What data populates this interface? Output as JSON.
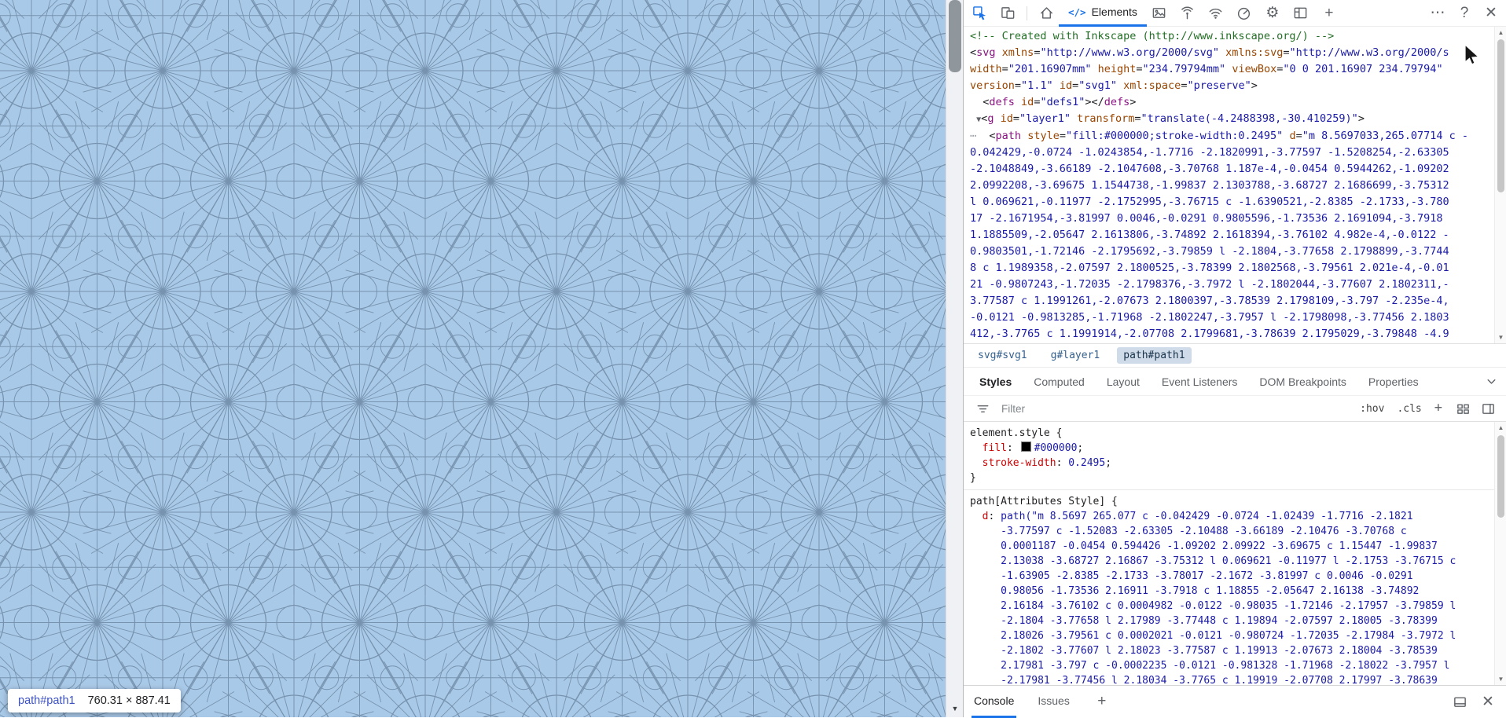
{
  "page": {
    "pattern": {
      "background": "#a9c9e8",
      "line_color": "#46607a"
    },
    "tooltip": {
      "element": "path#path1",
      "dimensions": "760.31 × 887.41"
    }
  },
  "devtools": {
    "toolbar": {
      "left_icons": [
        {
          "name": "inspect-icon",
          "active": true
        },
        {
          "name": "device-toolbar-icon",
          "active": false
        }
      ],
      "home_icon": {
        "name": "home-icon"
      },
      "elements_tab": {
        "icon_text": "</>",
        "label": "Elements"
      },
      "tool_icons": [
        {
          "name": "media-icon"
        },
        {
          "name": "network-conditions-icon"
        },
        {
          "name": "wifi-icon"
        },
        {
          "name": "performance-icon"
        },
        {
          "name": "settings-gear-icon"
        },
        {
          "name": "layout-icon"
        },
        {
          "name": "add-tool-icon"
        }
      ],
      "window_icons": [
        {
          "name": "more-options-icon"
        },
        {
          "name": "help-icon"
        },
        {
          "name": "close-devtools-icon"
        }
      ]
    },
    "dom_tree": {
      "lines": [
        {
          "segments": [
            [
              "cm",
              "<!-- Created with Inkscape (http://www.inkscape.org/) -->"
            ]
          ]
        },
        {
          "segments": [
            [
              "pl",
              "<"
            ],
            [
              "tag",
              "svg"
            ],
            [
              "pl",
              " "
            ],
            [
              "at",
              "xmlns"
            ],
            [
              "pl",
              "="
            ],
            [
              "av",
              "\"http://www.w3.org/2000/svg\""
            ],
            [
              "pl",
              " "
            ],
            [
              "at",
              "xmlns:svg"
            ],
            [
              "pl",
              "="
            ],
            [
              "av",
              "\"http://www.w3.org/2000/s"
            ]
          ]
        },
        {
          "segments": [
            [
              "at",
              "width"
            ],
            [
              "pl",
              "="
            ],
            [
              "av",
              "\"201.16907mm\""
            ],
            [
              "pl",
              " "
            ],
            [
              "at",
              "height"
            ],
            [
              "pl",
              "="
            ],
            [
              "av",
              "\"234.79794mm\""
            ],
            [
              "pl",
              " "
            ],
            [
              "at",
              "viewBox"
            ],
            [
              "pl",
              "="
            ],
            [
              "av",
              "\"0 0 201.16907 234.79794\""
            ]
          ]
        },
        {
          "segments": [
            [
              "at",
              "version"
            ],
            [
              "pl",
              "="
            ],
            [
              "av",
              "\"1.1\""
            ],
            [
              "pl",
              " "
            ],
            [
              "at",
              "id"
            ],
            [
              "pl",
              "="
            ],
            [
              "av",
              "\"svg1\""
            ],
            [
              "pl",
              " "
            ],
            [
              "at",
              "xml:space"
            ],
            [
              "pl",
              "="
            ],
            [
              "av",
              "\"preserve\""
            ],
            [
              "pl",
              ">"
            ]
          ]
        },
        {
          "segments": [
            [
              "pl",
              "  <"
            ],
            [
              "tag",
              "defs"
            ],
            [
              "pl",
              " "
            ],
            [
              "at",
              "id"
            ],
            [
              "pl",
              "="
            ],
            [
              "av",
              "\"defs1\""
            ],
            [
              "pl",
              "></"
            ],
            [
              "tag",
              "defs"
            ],
            [
              "pl",
              ">"
            ]
          ]
        },
        {
          "segments": [
            [
              "pl",
              " "
            ],
            [
              "arw",
              "▼"
            ],
            [
              "pl",
              "<"
            ],
            [
              "tag",
              "g"
            ],
            [
              "pl",
              " "
            ],
            [
              "at",
              "id"
            ],
            [
              "pl",
              "="
            ],
            [
              "av",
              "\"layer1\""
            ],
            [
              "pl",
              " "
            ],
            [
              "at",
              "transform"
            ],
            [
              "pl",
              "="
            ],
            [
              "av",
              "\"translate(-4.2488398,-30.410259)\""
            ],
            [
              "pl",
              ">"
            ]
          ]
        },
        {
          "segments": [
            [
              "gut",
              "⋯"
            ],
            [
              "pl",
              "  <"
            ],
            [
              "tag",
              "path"
            ],
            [
              "pl",
              " "
            ],
            [
              "at",
              "style"
            ],
            [
              "pl",
              "="
            ],
            [
              "av",
              "\"fill:#000000;stroke-width:0.2495\""
            ],
            [
              "pl",
              " "
            ],
            [
              "at",
              "d"
            ],
            [
              "pl",
              "="
            ],
            [
              "av",
              "\"m 8.5697033,265.07714 c -"
            ]
          ]
        },
        {
          "segments": [
            [
              "av",
              "0.042429,-0.0724 -1.0243854,-1.7716 -2.1820991,-3.77597 -1.5208254,-2.63305"
            ]
          ]
        },
        {
          "segments": [
            [
              "av",
              "-2.1048849,-3.66189 -2.1047608,-3.70768 1.187e-4,-0.0454 0.5944262,-1.09202"
            ]
          ]
        },
        {
          "segments": [
            [
              "av",
              "2.0992208,-3.69675 1.1544738,-1.99837 2.1303788,-3.68727 2.1686699,-3.75312"
            ]
          ]
        },
        {
          "segments": [
            [
              "av",
              "l 0.069621,-0.11977 -2.1752995,-3.76715 c -1.6390521,-2.8385 -2.1733,-3.780"
            ]
          ]
        },
        {
          "segments": [
            [
              "av",
              "17 -2.1671954,-3.81997 0.0046,-0.0291 0.9805596,-1.73536 2.1691094,-3.7918"
            ]
          ]
        },
        {
          "segments": [
            [
              "av",
              "1.1885509,-2.05647 2.1613806,-3.74892 2.1618394,-3.76102 4.982e-4,-0.0122 -"
            ]
          ]
        },
        {
          "segments": [
            [
              "av",
              "0.9803501,-1.72146 -2.1795692,-3.79859 l -2.1804,-3.77658 2.1798899,-3.7744"
            ]
          ]
        },
        {
          "segments": [
            [
              "av",
              "8 c 1.1989358,-2.07597 2.1800525,-3.78399 2.1802568,-3.79561 2.021e-4,-0.01"
            ]
          ]
        },
        {
          "segments": [
            [
              "av",
              "21 -0.9807243,-1.72035 -2.1798376,-3.7972 l -2.1802044,-3.77607 2.1802311,-"
            ]
          ]
        },
        {
          "segments": [
            [
              "av",
              "3.77587 c 1.1991261,-2.07673 2.1800397,-3.78539 2.1798109,-3.797 -2.235e-4,"
            ]
          ]
        },
        {
          "segments": [
            [
              "av",
              "-0.0121 -0.9813285,-1.71968 -2.1802247,-3.7957 l -2.1798098,-3.77456 2.1803"
            ]
          ]
        },
        {
          "segments": [
            [
              "av",
              "412,-3.7765 c 1.1991914,-2.07708 2.1799681,-3.78639 2.1795029,-3.79848 -4.9"
            ]
          ]
        }
      ]
    },
    "breadcrumb": {
      "items": [
        {
          "label": "svg#svg1",
          "selected": false
        },
        {
          "label": "g#layer1",
          "selected": false
        },
        {
          "label": "path#path1",
          "selected": true
        }
      ]
    },
    "panel_tabs": {
      "items": [
        {
          "label": "Styles",
          "selected": true
        },
        {
          "label": "Computed",
          "selected": false
        },
        {
          "label": "Layout",
          "selected": false
        },
        {
          "label": "Event Listeners",
          "selected": false
        },
        {
          "label": "DOM Breakpoints",
          "selected": false
        },
        {
          "label": "Properties",
          "selected": false
        }
      ]
    },
    "filter_bar": {
      "placeholder": "Filter",
      "pseudo_toggle": ":hov",
      "class_toggle": ".cls",
      "new_rule": "+",
      "icons": [
        {
          "name": "grid-icon"
        },
        {
          "name": "sidebar-icon"
        }
      ]
    },
    "styles_pane": {
      "rules": [
        {
          "lines": [
            {
              "segments": [
                [
                  "sel",
                  "element.style"
                ],
                [
                  "pl",
                  " {"
                ]
              ]
            },
            {
              "segments": [
                [
                  "prop",
                  "  fill"
                ],
                [
                  "pl",
                  ": "
                ],
                [
                  "swatch",
                  "#000000"
                ],
                [
                  "val",
                  "#000000"
                ],
                [
                  "pl",
                  ";"
                ]
              ]
            },
            {
              "segments": [
                [
                  "prop",
                  "  stroke-width"
                ],
                [
                  "pl",
                  ": "
                ],
                [
                  "val",
                  "0.2495"
                ],
                [
                  "pl",
                  ";"
                ]
              ]
            },
            {
              "segments": [
                [
                  "pl",
                  "}"
                ]
              ]
            }
          ]
        },
        {
          "lines": [
            {
              "segments": [
                [
                  "sel",
                  "path[Attributes Style]"
                ],
                [
                  "pl",
                  " {"
                ]
              ]
            },
            {
              "segments": [
                [
                  "prop",
                  "  d"
                ],
                [
                  "pl",
                  ": "
                ],
                [
                  "val",
                  "path(\"m 8.5697 265.077 c -0.042429 -0.0724 -1.02439 -1.7716 -2.1821"
                ]
              ]
            },
            {
              "segments": [
                [
                  "val",
                  "     -3.77597 c -1.52083 -2.63305 -2.10488 -3.66189 -2.10476 -3.70768 c"
                ]
              ]
            },
            {
              "segments": [
                [
                  "val",
                  "     0.0001187 -0.0454 0.594426 -1.09202 2.09922 -3.69675 c 1.15447 -1.99837"
                ]
              ]
            },
            {
              "segments": [
                [
                  "val",
                  "     2.13038 -3.68727 2.16867 -3.75312 l 0.069621 -0.11977 l -2.1753 -3.76715 c"
                ]
              ]
            },
            {
              "segments": [
                [
                  "val",
                  "     -1.63905 -2.8385 -2.1733 -3.78017 -2.1672 -3.81997 c 0.0046 -0.0291"
                ]
              ]
            },
            {
              "segments": [
                [
                  "val",
                  "     0.98056 -1.73536 2.16911 -3.7918 c 1.18855 -2.05647 2.16138 -3.74892"
                ]
              ]
            },
            {
              "segments": [
                [
                  "val",
                  "     2.16184 -3.76102 c 0.0004982 -0.0122 -0.98035 -1.72146 -2.17957 -3.79859 l"
                ]
              ]
            },
            {
              "segments": [
                [
                  "val",
                  "     -2.1804 -3.77658 l 2.17989 -3.77448 c 1.19894 -2.07597 2.18005 -3.78399"
                ]
              ]
            },
            {
              "segments": [
                [
                  "val",
                  "     2.18026 -3.79561 c 0.0002021 -0.0121 -0.980724 -1.72035 -2.17984 -3.7972 l"
                ]
              ]
            },
            {
              "segments": [
                [
                  "val",
                  "     -2.1802 -3.77607 l 2.18023 -3.77587 c 1.19913 -2.07673 2.18004 -3.78539"
                ]
              ]
            },
            {
              "segments": [
                [
                  "val",
                  "     2.17981 -3.797 c -0.0002235 -0.0121 -0.981328 -1.71968 -2.18022 -3.7957 l"
                ]
              ]
            },
            {
              "segments": [
                [
                  "val",
                  "     -2.17981 -3.77456 l 2.18034 -3.7765 c 1.19919 -2.07708 2.17997 -3.78639"
                ]
              ]
            }
          ]
        }
      ]
    },
    "console_bar": {
      "tabs": [
        {
          "label": "Console",
          "selected": true
        },
        {
          "label": "Issues",
          "selected": false
        }
      ],
      "add_icon": {
        "name": "add-pane-icon"
      },
      "right_icons": [
        {
          "name": "dock-icon"
        },
        {
          "name": "close-drawer-icon"
        }
      ]
    },
    "accent_color": "#1a73e8"
  }
}
